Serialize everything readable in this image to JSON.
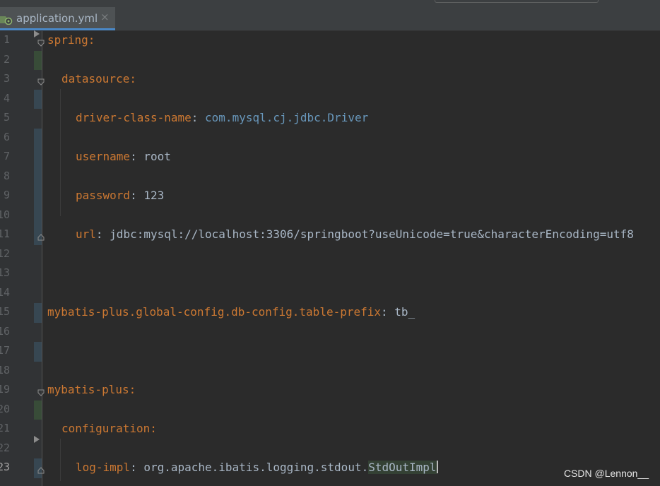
{
  "tab": {
    "label": "application.yml",
    "close_glyph": "×",
    "icon": "yaml-spring-file-icon"
  },
  "editor": {
    "current_line": "23",
    "lines": [
      {
        "n": "1",
        "key": "spring",
        "sep": ":",
        "val": ""
      },
      {
        "n": "2"
      },
      {
        "n": "3",
        "key": "datasource",
        "sep": ":",
        "val": ""
      },
      {
        "n": "4"
      },
      {
        "n": "5",
        "key": "driver-class-name",
        "sep": ": ",
        "val": "com.mysql.cj.jdbc.Driver"
      },
      {
        "n": "6"
      },
      {
        "n": "7",
        "key": "username",
        "sep": ": ",
        "val": "root"
      },
      {
        "n": "8"
      },
      {
        "n": "9",
        "key": "password",
        "sep": ": ",
        "val": "123"
      },
      {
        "n": "10"
      },
      {
        "n": "11",
        "key": "url",
        "sep": ": ",
        "val": "jdbc:mysql://localhost:3306/springboot?useUnicode=true&characterEncoding=utf8"
      },
      {
        "n": "12"
      },
      {
        "n": "13"
      },
      {
        "n": "14"
      },
      {
        "n": "15",
        "key": "mybatis-plus.global-config.db-config.table-prefix",
        "sep": ": ",
        "val": "tb_"
      },
      {
        "n": "16"
      },
      {
        "n": "17"
      },
      {
        "n": "18"
      },
      {
        "n": "19",
        "key": "mybatis-plus",
        "sep": ":",
        "val": ""
      },
      {
        "n": "20"
      },
      {
        "n": "21",
        "key": "configuration",
        "sep": ":",
        "val": ""
      },
      {
        "n": "22"
      },
      {
        "n": "23",
        "key": "log-impl",
        "sep": ": ",
        "val_prefix": "org.apache.ibatis.logging.stdout.",
        "val_highlight": "StdOutImpl"
      }
    ]
  },
  "watermark": "CSDN @Lennon__",
  "colors": {
    "background": "#2b2b2b",
    "key": "#cc7832",
    "value": "#a9b7c6",
    "class_value": "#6897bb",
    "line_number": "#606366",
    "added_marker": "#384c38",
    "modified_marker": "#374752",
    "tab_underline": "#4a88c7"
  }
}
